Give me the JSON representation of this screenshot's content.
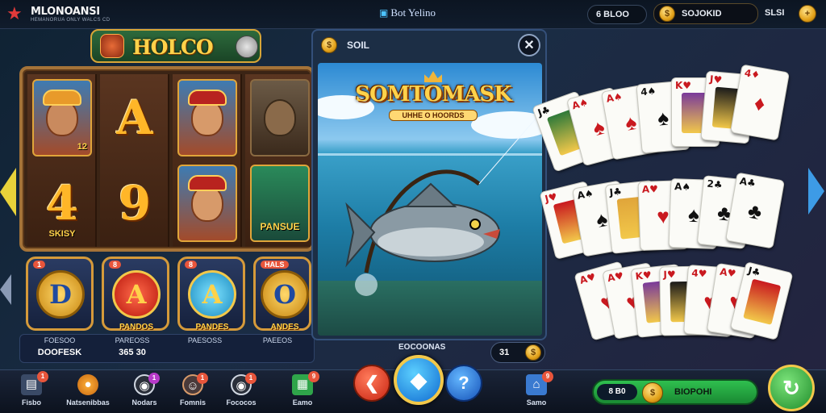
{
  "topbar": {
    "brand": "MLONOANSI",
    "brand_tagline": "HEMANORUA ONLY WALCS CD",
    "title": "Bot Yelino",
    "left_pill": "6 BLOO",
    "coins": "SOJOKID",
    "right_label": "SLSI"
  },
  "slot": {
    "title": "HOLCO",
    "reels": [
      [
        "portrait-12",
        "4"
      ],
      [
        "A",
        "9"
      ],
      [
        "portrait",
        "portrait"
      ],
      [
        "portrait-gray",
        "PANSUE"
      ]
    ],
    "reel_labels": {
      "c0_top_badge": "12",
      "c0_bottom_caption": "SKISY",
      "c3_bottom_caption": "PANSUE"
    },
    "tokens": [
      {
        "badge": "1",
        "symbol": "D",
        "caption": ""
      },
      {
        "badge": "8",
        "symbol": "A",
        "caption": "PANDOS"
      },
      {
        "badge": "8",
        "symbol": "A",
        "caption": "PANDES"
      },
      {
        "badge": "HALS",
        "symbol": "O",
        "caption": "ANDES"
      }
    ],
    "info": [
      {
        "label": "FOESOO",
        "value": "DOOFESK"
      },
      {
        "label": "PAREOSS",
        "value": "365 30"
      },
      {
        "label": "PAESOSS",
        "value": ""
      },
      {
        "label": "PAEEOS",
        "value": ""
      }
    ]
  },
  "fishing": {
    "header_label": "SOIL",
    "logo_title": "SOMTOMASK",
    "logo_subtitle": "UHHE O HOORDS",
    "footer_label": "EOCOONAS",
    "count": "31"
  },
  "cards": {
    "row1": [
      {
        "rank": "J",
        "suit": "♣",
        "color": "black"
      },
      {
        "rank": "A",
        "suit": "♠",
        "color": "red"
      },
      {
        "rank": "A",
        "suit": "♠",
        "color": "red"
      },
      {
        "rank": "4",
        "suit": "♠",
        "color": "black"
      },
      {
        "rank": "K",
        "suit": "♥",
        "color": "red"
      },
      {
        "rank": "J",
        "suit": "♥",
        "color": "red"
      },
      {
        "rank": "4",
        "suit": "♦",
        "color": "red"
      }
    ],
    "row2": [
      {
        "rank": "J",
        "suit": "♥",
        "color": "red"
      },
      {
        "rank": "A",
        "suit": "♠",
        "color": "black"
      },
      {
        "rank": "J",
        "suit": "♣",
        "color": "black"
      },
      {
        "rank": "A",
        "suit": "♥",
        "color": "red"
      },
      {
        "rank": "A",
        "suit": "♠",
        "color": "black"
      },
      {
        "rank": "2",
        "suit": "♣",
        "color": "black"
      },
      {
        "rank": "A",
        "suit": "♣",
        "color": "black"
      }
    ],
    "row3": [
      {
        "rank": "A",
        "suit": "♥",
        "color": "red"
      },
      {
        "rank": "A",
        "suit": "♥",
        "color": "red"
      },
      {
        "rank": "K",
        "suit": "♥",
        "color": "red"
      },
      {
        "rank": "J",
        "suit": "♥",
        "color": "red"
      },
      {
        "rank": "4",
        "suit": "♥",
        "color": "red"
      },
      {
        "rank": "A",
        "suit": "♥",
        "color": "red"
      },
      {
        "rank": "J",
        "suit": "♣",
        "color": "black"
      }
    ]
  },
  "bottom_nav": [
    {
      "label": "Fisbo",
      "badge": "1",
      "icon": "document-icon"
    },
    {
      "label": "Natsenibbas",
      "badge": "",
      "icon": "coin-icon"
    },
    {
      "label": "Nodars",
      "badge": "1",
      "icon": "chip-icon"
    },
    {
      "label": "Fomnis",
      "badge": "1",
      "icon": "face-icon"
    },
    {
      "label": "Fococos",
      "badge": "1",
      "icon": "chip-icon"
    },
    {
      "label": "Eamo",
      "badge": "9",
      "icon": "slot-icon"
    },
    {
      "label": "Samo",
      "badge": "9",
      "icon": "home-icon"
    }
  ],
  "bet": {
    "left": "8 B0",
    "label": "BIOPOHI"
  },
  "colors": {
    "accent_gold": "#f2c84a",
    "green": "#2fbf4f",
    "blue": "#0f6ad0",
    "red": "#c82512"
  }
}
